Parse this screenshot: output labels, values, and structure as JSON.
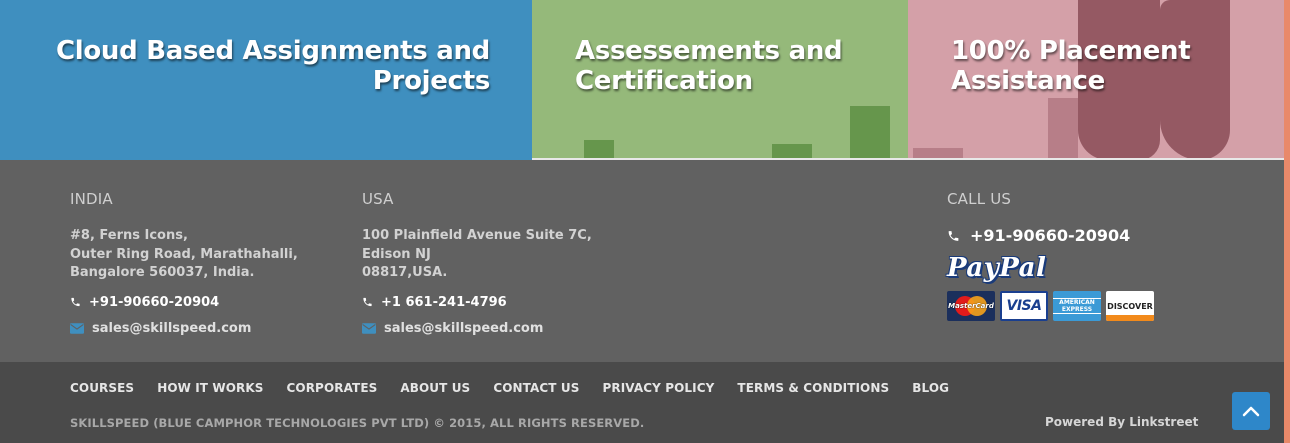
{
  "features": [
    {
      "title": "Cloud Based Assignments and Projects",
      "color": "#3f8fbf"
    },
    {
      "title": "Assessements and Certification",
      "color": "#95b97a"
    },
    {
      "title": "100% Placement Assistance",
      "color": "#d4a0a8"
    }
  ],
  "india": {
    "heading": "INDIA",
    "address": [
      "#8, Ferns Icons,",
      "Outer Ring Road, Marathahalli,",
      "Bangalore 560037, India."
    ],
    "phone": "+91-90660-20904",
    "email": "sales@skillspeed.com"
  },
  "usa": {
    "heading": "USA",
    "address": [
      "100 Plainfield Avenue Suite 7C,",
      "Edison NJ",
      "08817,USA."
    ],
    "phone": "+1 661-241-4796",
    "email": "sales@skillspeed.com"
  },
  "call": {
    "heading": "CALL US",
    "phone": "+91-90660-20904",
    "paypal": "PayPal",
    "cards": [
      "MasterCard",
      "VISA",
      "AMERICAN EXPRESS",
      "DISCOVER"
    ]
  },
  "nav": [
    "COURSES",
    "HOW IT WORKS",
    "CORPORATES",
    "ABOUT US",
    "CONTACT US",
    "PRIVACY POLICY",
    "TERMS & CONDITIONS",
    "BLOG"
  ],
  "copyright": "SKILLSPEED (BLUE CAMPHOR TECHNOLOGIES PVT LTD) © 2015, ALL RIGHTS RESERVED.",
  "powered_by": "Powered By Linkstreet",
  "icons": {
    "phone": "phone-icon",
    "mail": "envelope-icon",
    "top": "chevron-up-icon"
  },
  "colors": {
    "accent": "#2e87c9",
    "footer": "#616161",
    "bottom_bar": "#4a4a4a"
  }
}
